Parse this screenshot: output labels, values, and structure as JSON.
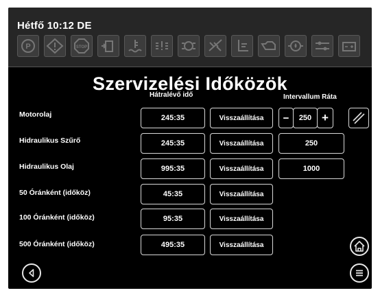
{
  "header": {
    "clock": "Hétfő 10:12 DE",
    "warning_icons": [
      "parking-brake-icon",
      "warning-triangle-icon",
      "stop-icon",
      "fuel-filter-icon",
      "coolant-temperature-icon",
      "engine-warning-icon",
      "transmission-warning-icon",
      "regen-disabled-icon",
      "exhaust-temperature-icon",
      "engine-oil-icon",
      "hydraulic-oil-icon",
      "hydraulic-filter-icon",
      "battery-icon"
    ]
  },
  "page": {
    "title": "Szervizelési Időközök",
    "col_remaining": "Hátralévő idő",
    "col_interval": "Intervallum Ráta"
  },
  "rows": [
    {
      "label": "Motorolaj",
      "remaining": "245:35",
      "reset_label": "Visszaállítása",
      "interval": "250"
    },
    {
      "label": "Hidraulikus Szűrő",
      "remaining": "245:35",
      "reset_label": "Visszaállítása",
      "interval": "250"
    },
    {
      "label": "Hidraulikus Olaj",
      "remaining": "995:35",
      "reset_label": "Visszaállítása",
      "interval": "1000"
    },
    {
      "label": "50 Óránként (időköz)",
      "remaining": "45:35",
      "reset_label": "Visszaállítása",
      "interval": ""
    },
    {
      "label": "100 Óránként (időköz)",
      "remaining": "95:35",
      "reset_label": "Visszaállítása",
      "interval": ""
    },
    {
      "label": "500 Óránként (időköz)",
      "remaining": "495:35",
      "reset_label": "Visszaállítása",
      "interval": ""
    }
  ],
  "stepper": {
    "minus": "−",
    "plus": "+"
  },
  "icons": {
    "back": "back-arrow-icon",
    "home": "home-icon",
    "menu": "menu-icon",
    "edit": "edit-slash-icon"
  },
  "colors": {
    "background": "#000000",
    "header": "#262626",
    "text": "#ffffff",
    "border": "#d9d9d9"
  }
}
